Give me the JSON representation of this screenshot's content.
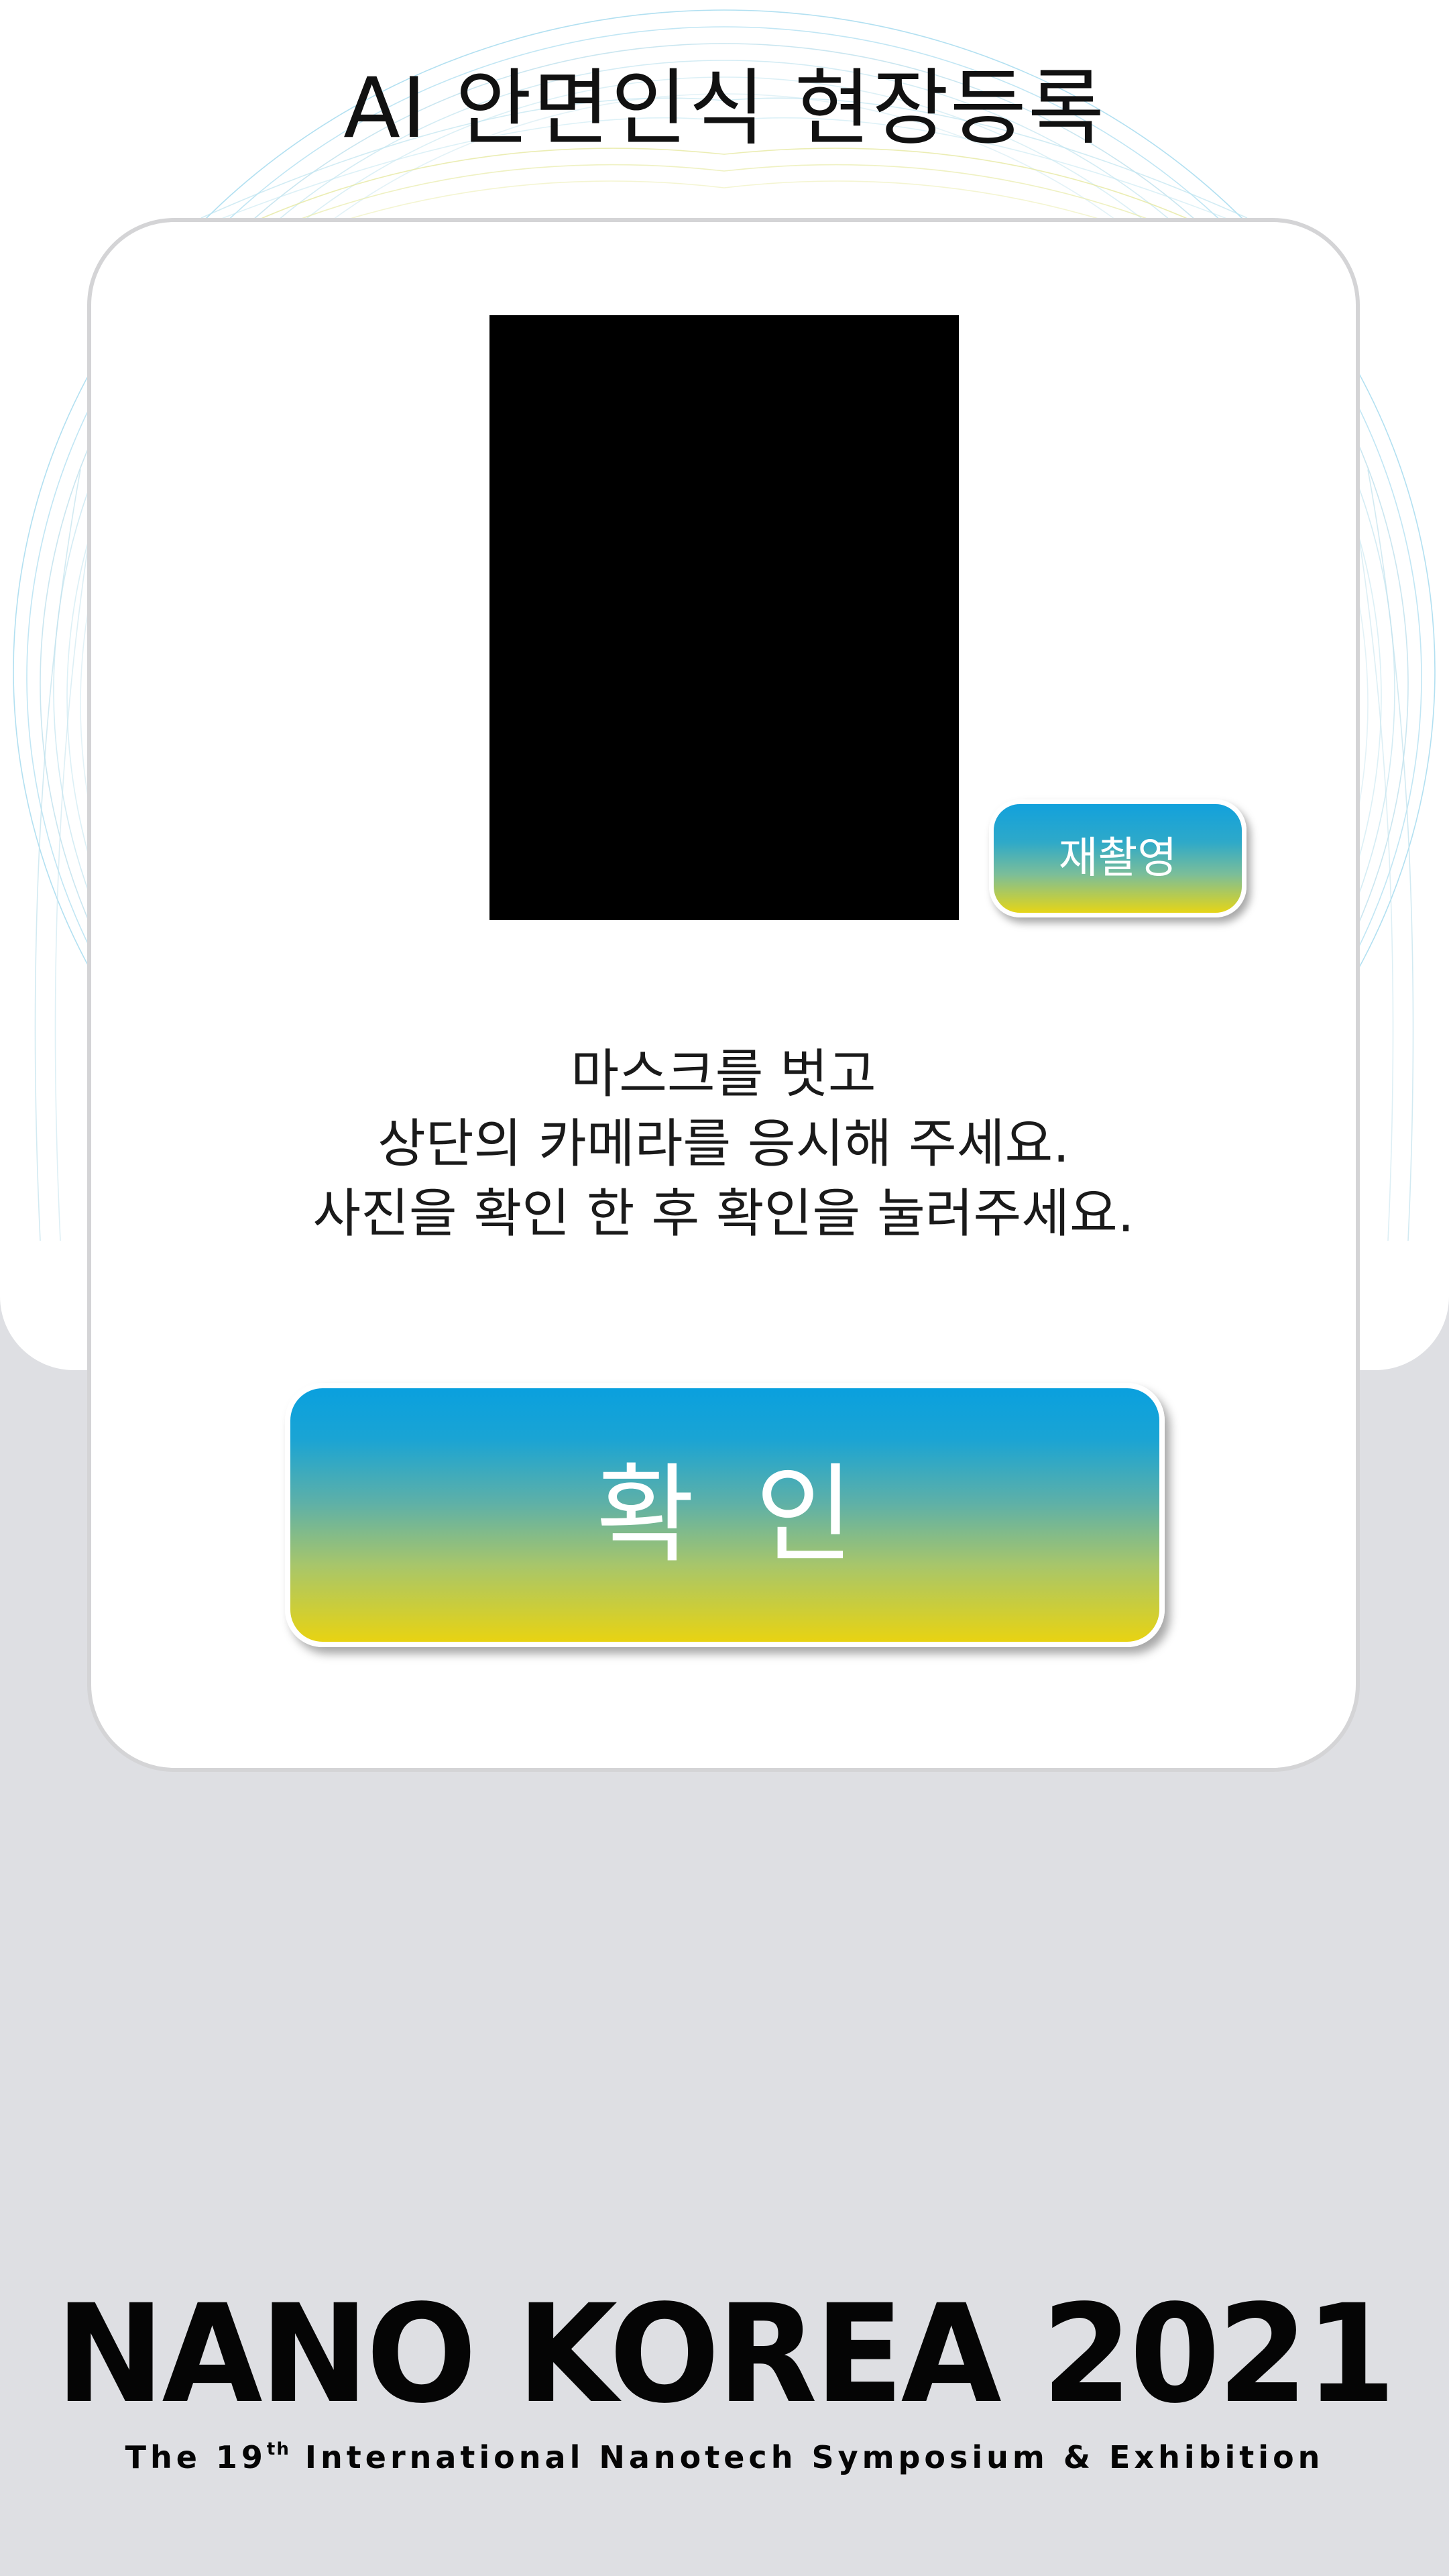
{
  "header": {
    "title": "AI 안면인식 현장등록"
  },
  "capture": {
    "retake_label": "재촬영"
  },
  "instructions": {
    "line1": "마스크를 벗고",
    "line2": "상단의 카메라를 응시해 주세요.",
    "line3": "사진을 확인 한 후 확인을 눌러주세요."
  },
  "confirm": {
    "label": "확인"
  },
  "footer": {
    "event_title": "NANO KOREA 2021",
    "subtitle_prefix": "The 19",
    "subtitle_ordinal": "th",
    "subtitle_suffix": " International Nanotech Symposium & Exhibition"
  },
  "colors": {
    "gradient_top": "#0aa0de",
    "gradient_bottom": "#e8d312",
    "background": "#dedfe3"
  }
}
